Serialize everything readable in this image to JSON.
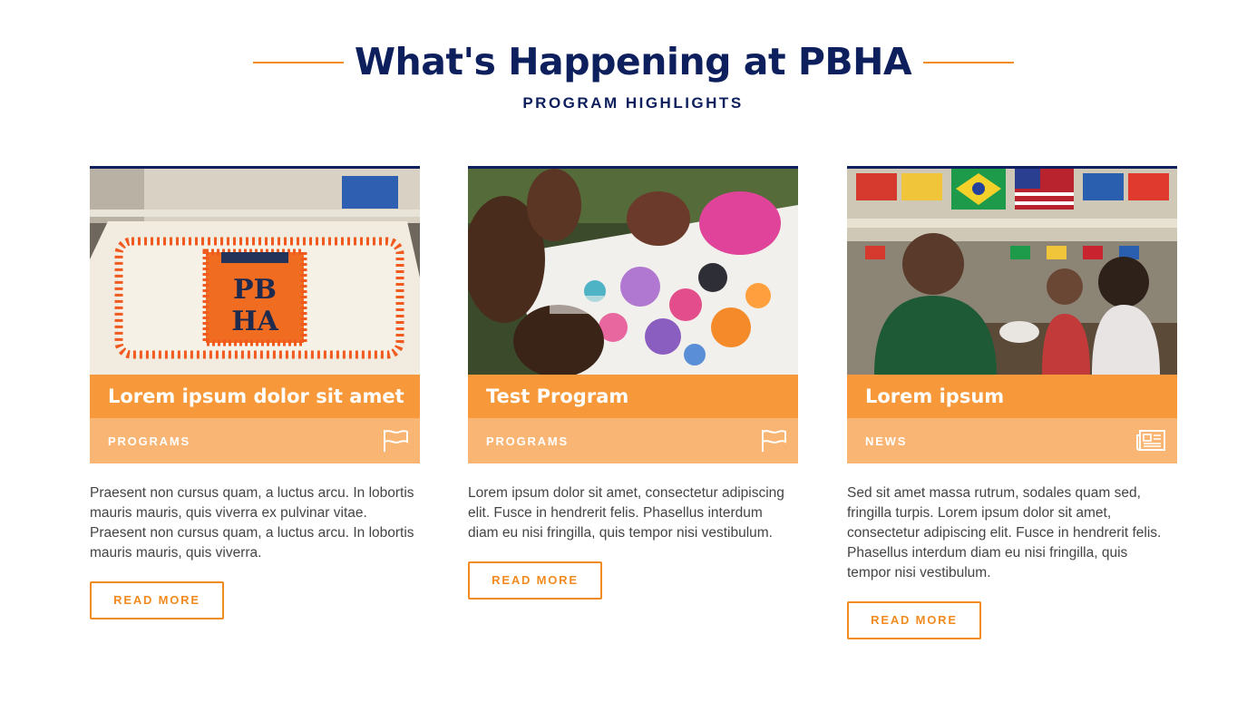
{
  "section": {
    "title": "What's Happening at PBHA",
    "subtitle": "PROGRAM HIGHLIGHTS",
    "accent_color": "#f18a1f",
    "navy_color": "#0d1f5c"
  },
  "cards": [
    {
      "title": "Lorem ipsum dolor sit amet",
      "category": "PROGRAMS",
      "category_icon": "flag-icon",
      "excerpt": "Praesent non cursus quam, a luctus arcu. In lobortis mauris mauris, quis viverra ex pulvinar vitae. Praesent non cursus quam, a luctus arcu. In lobortis mauris mauris, quis viverra.",
      "button_label": "READ MORE",
      "image_alt": "Sheet cake decorated with PBHA logo in orange frosting",
      "image_text": {
        "line1": "PB",
        "line2": "HA"
      }
    },
    {
      "title": "Test Program",
      "category": "PROGRAMS",
      "category_icon": "flag-icon",
      "excerpt": "Lorem ipsum dolor sit amet, consectetur adipiscing elit. Fusce in hendrerit felis. Phasellus interdum diam eu nisi fringilla, quis tempor nisi vestibulum.",
      "button_label": "READ MORE",
      "image_alt": "Children painting on a large sheet of paper outdoors"
    },
    {
      "title": "Lorem ipsum",
      "category": "NEWS",
      "category_icon": "newspaper-icon",
      "excerpt": "Sed sit amet massa rutrum, sodales quam sed, fringilla turpis. Lorem ipsum dolor sit amet, consectetur adipiscing elit. Fusce in hendrerit felis. Phasellus interdum diam eu nisi fringilla, quis tempor nisi vestibulum.",
      "button_label": "READ MORE",
      "image_alt": "Students talking at a table beneath international flags"
    }
  ]
}
